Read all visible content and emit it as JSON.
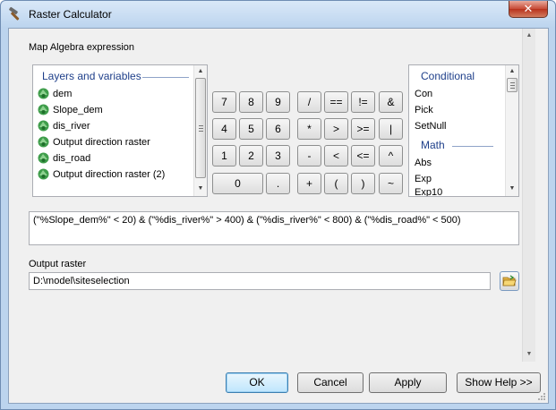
{
  "window": {
    "title": "Raster Calculator",
    "close_glyph": "✕"
  },
  "expression_section": {
    "label": "Map Algebra expression"
  },
  "layers_panel": {
    "header": "Layers and variables",
    "items": [
      {
        "label": "dem"
      },
      {
        "label": "Slope_dem"
      },
      {
        "label": "dis_river"
      },
      {
        "label": "Output direction raster"
      },
      {
        "label": "dis_road"
      },
      {
        "label": "Output direction raster (2)"
      }
    ]
  },
  "keypad": {
    "rows": [
      [
        "7",
        "8",
        "9",
        "/",
        "==",
        "!=",
        "&"
      ],
      [
        "4",
        "5",
        "6",
        "*",
        ">",
        ">=",
        "|"
      ],
      [
        "1",
        "2",
        "3",
        "-",
        "<",
        "<=",
        "^"
      ],
      [
        "0",
        ".",
        "+",
        "(",
        ")",
        "~"
      ]
    ]
  },
  "functions_panel": {
    "header_conditional": "Conditional",
    "conditional_items": [
      {
        "label": "Con"
      },
      {
        "label": "Pick"
      },
      {
        "label": "SetNull"
      }
    ],
    "header_math": "Math",
    "math_items": [
      {
        "label": "Abs"
      },
      {
        "label": "Exp"
      },
      {
        "label": "Exp10"
      }
    ]
  },
  "expression": {
    "value": "(\"%Slope_dem%\" < 20) & (\"%dis_river%\" > 400) & (\"%dis_river%\" < 800) & (\"%dis_road%\" < 500)"
  },
  "output": {
    "label": "Output raster",
    "value": "D:\\model\\siteselection"
  },
  "buttons": {
    "ok": "OK",
    "cancel": "Cancel",
    "apply": "Apply",
    "help": "Show Help >>"
  },
  "colors": {
    "header_text": "#1e3f8a",
    "window_frame": "#bcd4ee",
    "close_button": "#c74a36"
  },
  "icons": {
    "title": "hammer-icon",
    "layer": "raster-layer-icon",
    "browse": "open-folder-icon"
  }
}
